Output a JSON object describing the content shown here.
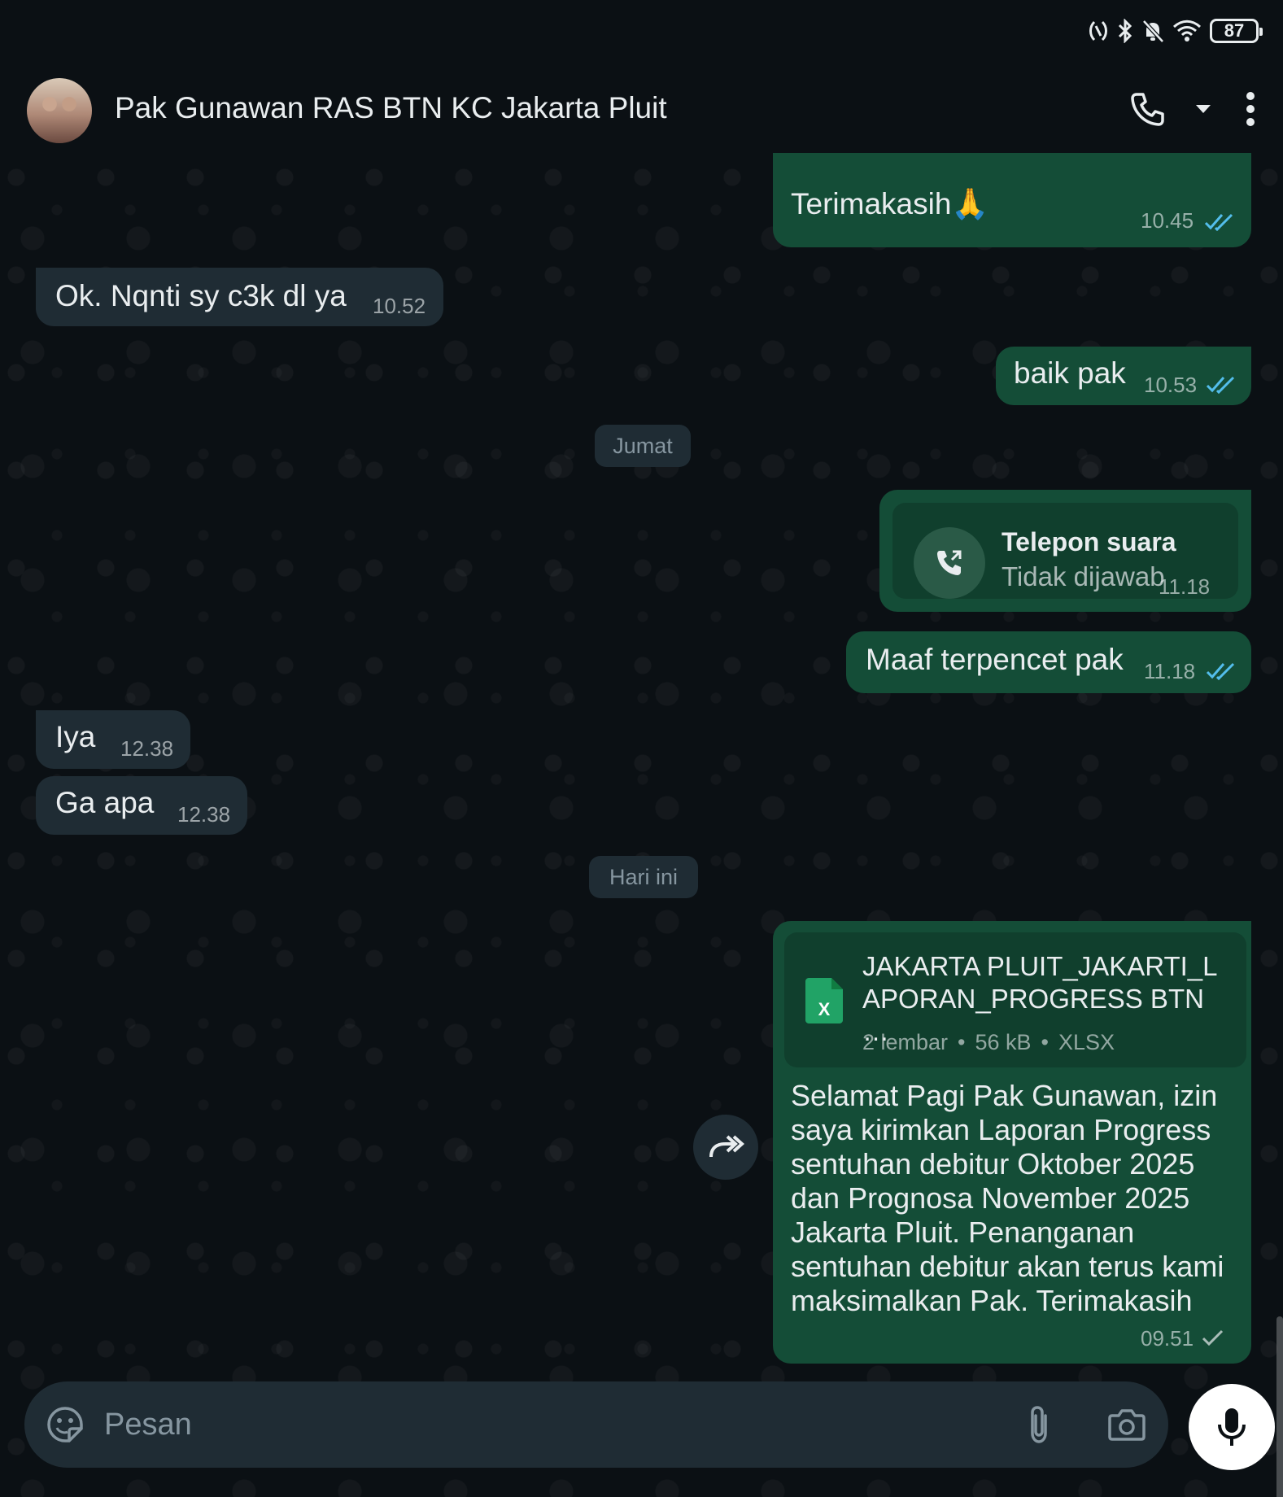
{
  "status_bar": {
    "battery": "87"
  },
  "header": {
    "contact_name": "Pak Gunawan RAS BTN KC Jakarta Pluit"
  },
  "messages": [
    {
      "text": "Terimakasih",
      "emoji": "🙏",
      "time": "10.45"
    },
    {
      "text": "Ok. Nqnti sy c3k dl ya",
      "time": "10.52"
    },
    {
      "text": "baik pak",
      "time": "10.53"
    },
    {
      "text": "Iya",
      "time": "12.38"
    },
    {
      "text": "Ga apa",
      "time": "12.38"
    },
    {
      "text": "Maaf terpencet pak",
      "time": "11.18"
    }
  ],
  "date_separators": [
    "Jumat",
    "Hari ini"
  ],
  "call": {
    "title": "Telepon suara",
    "subtitle": "Tidak dijawab",
    "time": "11.18"
  },
  "document": {
    "name_line1": "JAKARTA PLUIT_JAKARTI_L",
    "name_line2": "APORAN_PROGRESS BTN …",
    "pages": "2 lembar",
    "size": "56 kB",
    "type": "XLSX",
    "caption": "Selamat Pagi Pak Gunawan, izin saya kirimkan Laporan Progress sentuhan debitur Oktober 2025 dan Prognosa November 2025 Jakarta Pluit. Penanganan sentuhan debitur akan terus kami maksimalkan Pak. Terimakasih",
    "time": "09.51"
  },
  "composer": {
    "placeholder": "Pesan"
  },
  "colors": {
    "outgoing_bubble": "#144d37",
    "incoming_bubble": "#1f2c34",
    "read_ticks": "#53bdeb",
    "background": "#0b1014"
  }
}
